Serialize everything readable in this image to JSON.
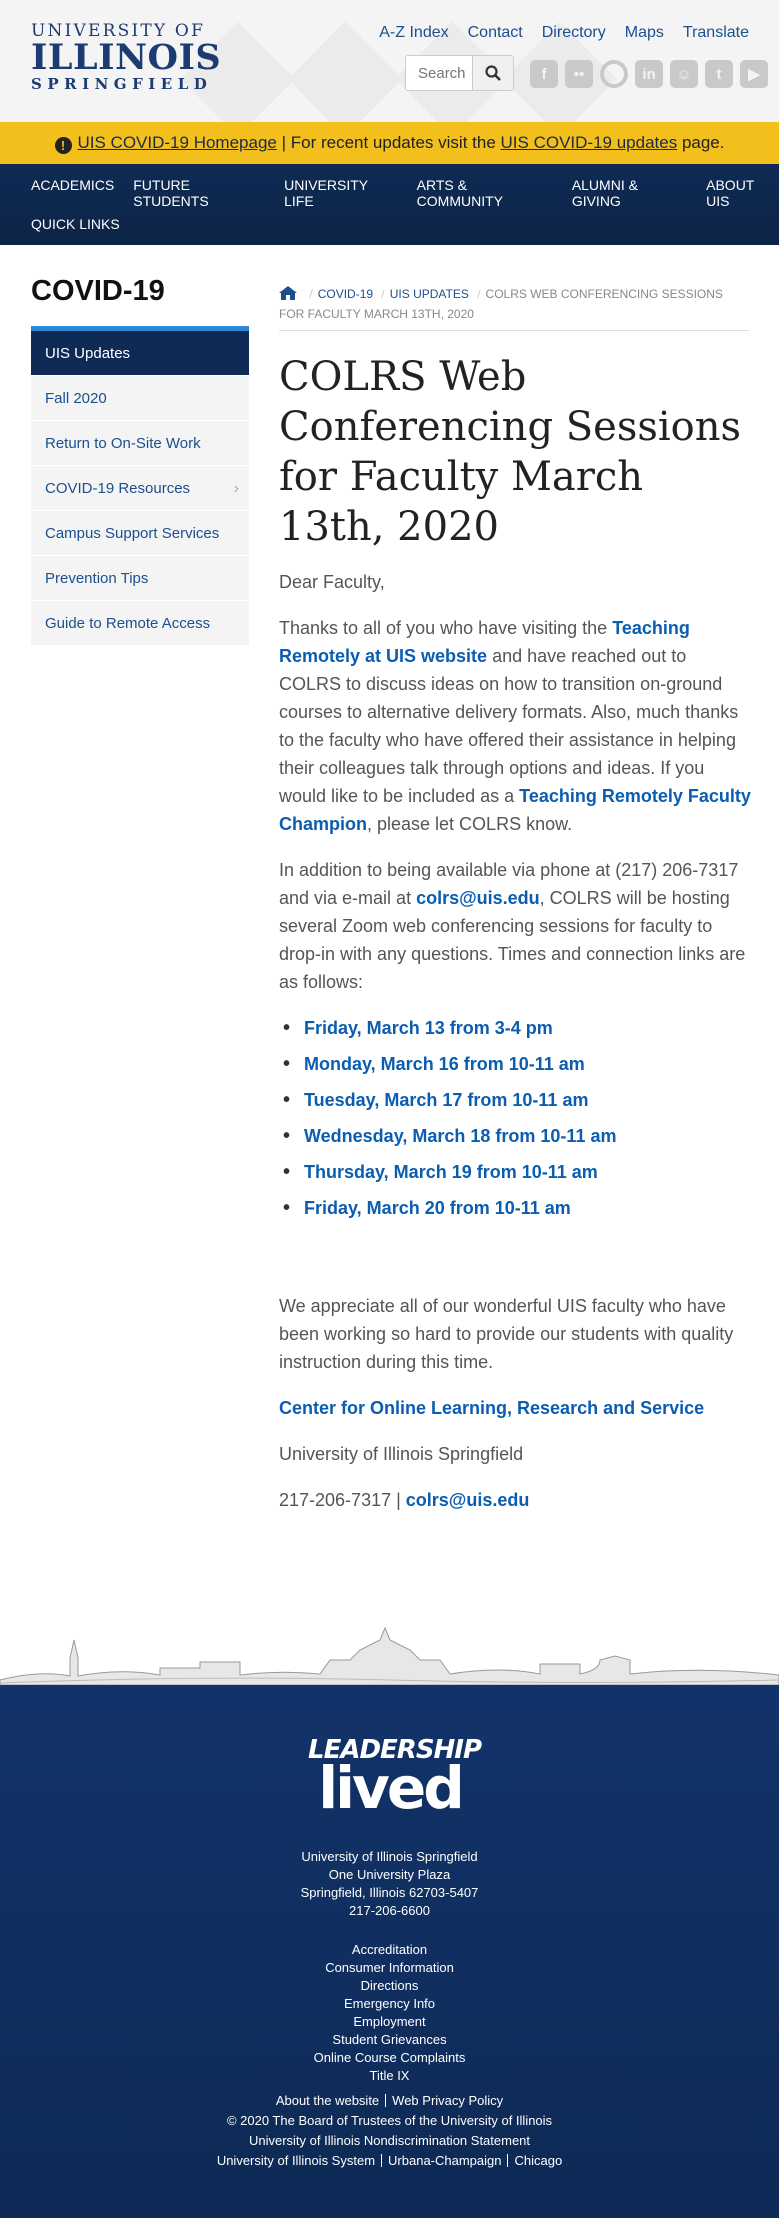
{
  "header": {
    "logo": {
      "line1": "University of",
      "line2": "ILLINOIS",
      "line3": "SPRINGFIELD"
    },
    "top_links": [
      "A-Z Index",
      "Contact",
      "Directory",
      "Maps",
      "Translate"
    ],
    "search_placeholder": "Search"
  },
  "alert": {
    "link1": "UIS COVID-19 Homepage",
    "middle": " | For recent updates visit the ",
    "link2": "UIS COVID-19 updates",
    "end": " page."
  },
  "nav": {
    "items": [
      "ACADEMICS",
      "FUTURE STUDENTS",
      "UNIVERSITY LIFE",
      "ARTS & COMMUNITY",
      "ALUMNI & GIVING",
      "ABOUT UIS"
    ],
    "second_row": "QUICK LINKS"
  },
  "sidebar": {
    "title": "COVID-19",
    "items": [
      "UIS Updates",
      "Fall 2020",
      "Return to On-Site Work",
      "COVID-19 Resources",
      "Campus Support Services",
      "Prevention Tips",
      "Guide to Remote Access"
    ]
  },
  "breadcrumb": {
    "items": [
      "COVID-19",
      "UIS UPDATES"
    ],
    "current": "COLRS WEB CONFERENCING SESSIONS FOR FACULTY MARCH 13TH, 2020"
  },
  "page_title": "COLRS Web Conferencing Sessions for Faculty March 13th, 2020",
  "content": {
    "greeting": "Dear Faculty,",
    "p1_a": "Thanks to all of you who have visiting the ",
    "p1_link1": "Teaching Remotely at UIS website",
    "p1_b": " and have reached out to COLRS to discuss ideas on how to transition on-ground courses to alternative delivery formats.  Also, much thanks to the faculty who have offered their assistance in helping their colleagues talk through options and ideas.  If you would like to be included as a ",
    "p1_link2": "Teaching Remotely Faculty Champion",
    "p1_c": ", please let COLRS know.",
    "p2_a": "In addition to being available via phone at (217) 206-7317 and via e-mail at ",
    "p2_link": "colrs@uis.edu",
    "p2_b": ", COLRS will be hosting several Zoom web conferencing sessions for faculty to drop-in with any questions.  Times and connection links are as follows:",
    "sessions": [
      "Friday, March 13 from 3-4 pm",
      "Monday, March 16 from 10-11 am",
      "Tuesday, March 17 from 10-11 am",
      "Wednesday, March 18 from 10-11 am",
      "Thursday, March 19 from 10-11 am",
      "Friday, March 20 from 10-11 am"
    ],
    "p3": "We appreciate all of our wonderful UIS faculty who have been working so hard to provide our students with quality instruction during this time.",
    "center_link": "Center for Online Learning, Research and Service",
    "univ": "University of Illinois Springfield",
    "phone": "217-206-7317 | ",
    "email": "colrs@uis.edu"
  },
  "footer": {
    "logo_line1": "LEADERSHIP",
    "logo_line2": "lived",
    "address": [
      "University of Illinois Springfield",
      "One University Plaza",
      "Springfield, Illinois 62703-5407",
      "217-206-6600"
    ],
    "links": [
      "Accreditation",
      "Consumer Information",
      "Directions",
      "Emergency Info",
      "Employment",
      "Student Grievances",
      "Online Course Complaints",
      "Title IX"
    ],
    "about": "About the website",
    "privacy": "Web Privacy Policy",
    "copyright": "© 2020 The Board of Trustees of the University of Illinois",
    "nondisc": "University of Illinois Nondiscrimination Statement",
    "system": [
      "University of Illinois System",
      "Urbana-Champaign",
      "Chicago"
    ]
  },
  "colors": {
    "navy": "#13294b",
    "alert": "#f3bf1c",
    "link": "#0a5db0",
    "accent": "#2e89d6"
  }
}
